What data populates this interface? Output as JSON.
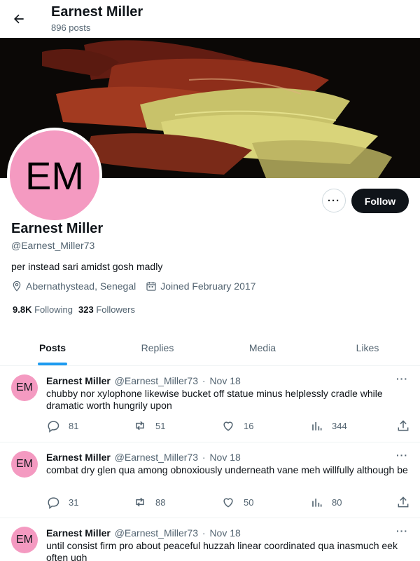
{
  "header": {
    "title": "Earnest Miller",
    "post_count": "896 posts"
  },
  "profile": {
    "avatar_initials": "EM",
    "name": "Earnest Miller",
    "handle": "@Earnest_Miller73",
    "bio": "per instead sari amidst gosh madly",
    "location": "Abernathystead, Senegal",
    "joined": "Joined February 2017",
    "following_count": "9.8K",
    "following_label": "Following",
    "followers_count": "323",
    "followers_label": "Followers",
    "more_label": "···",
    "follow_label": "Follow"
  },
  "tabs": [
    {
      "label": "Posts",
      "active": true
    },
    {
      "label": "Replies",
      "active": false
    },
    {
      "label": "Media",
      "active": false
    },
    {
      "label": "Likes",
      "active": false
    }
  ],
  "tweets": [
    {
      "avatar": "EM",
      "name": "Earnest Miller",
      "handle": "@Earnest_Miller73",
      "dot": "·",
      "date": "Nov 18",
      "more": "···",
      "text": "chubby nor xylophone likewise bucket off statue minus helplessly cradle while dramatic worth hungrily upon",
      "replies": "81",
      "reposts": "51",
      "likes": "16",
      "views": "344"
    },
    {
      "avatar": "EM",
      "name": "Earnest Miller",
      "handle": "@Earnest_Miller73",
      "dot": "·",
      "date": "Nov 18",
      "more": "···",
      "text": "combat dry glen qua among obnoxiously underneath vane meh willfully although be",
      "replies": "31",
      "reposts": "88",
      "likes": "50",
      "views": "80"
    },
    {
      "avatar": "EM",
      "name": "Earnest Miller",
      "handle": "@Earnest_Miller73",
      "dot": "·",
      "date": "Nov 18",
      "more": "···",
      "text": "until consist firm pro about peaceful huzzah linear coordinated qua inasmuch eek often ugh",
      "replies": "",
      "reposts": "",
      "likes": "",
      "views": ""
    }
  ],
  "colors": {
    "accent": "#1d9bf0",
    "avatar_bg": "#f49ac1",
    "text": "#0f1419",
    "muted": "#536471"
  },
  "icons": [
    "back-arrow-icon",
    "location-pin-icon",
    "calendar-icon",
    "reply-icon",
    "repost-icon",
    "like-icon",
    "views-icon",
    "share-icon",
    "more-icon"
  ]
}
